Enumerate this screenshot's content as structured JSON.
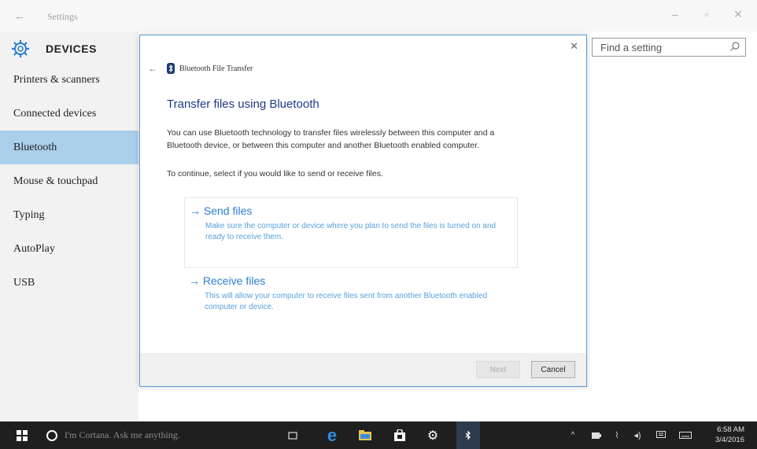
{
  "window": {
    "title": "Settings",
    "back_icon": "back-arrow-icon",
    "controls": [
      "minimize-icon",
      "maximize-icon",
      "close-icon"
    ]
  },
  "sidebar": {
    "header": "DEVICES",
    "header_icon": "gear-icon",
    "items": [
      {
        "label": "Printers & scanners",
        "active": false
      },
      {
        "label": "Connected devices",
        "active": false
      },
      {
        "label": "Bluetooth",
        "active": true
      },
      {
        "label": "Mouse & touchpad",
        "active": false
      },
      {
        "label": "Typing",
        "active": false
      },
      {
        "label": "AutoPlay",
        "active": false
      },
      {
        "label": "USB",
        "active": false
      }
    ]
  },
  "search": {
    "placeholder": "Find a setting",
    "icon": "search-icon"
  },
  "dialog": {
    "header_title": "Bluetooth File Transfer",
    "title": "Transfer files using Bluetooth",
    "description": "You can use Bluetooth technology to transfer files wirelessly between this computer and a Bluetooth device, or between this computer and another Bluetooth enabled computer.",
    "prompt": "To continue, select if you would like to send or receive files.",
    "options": [
      {
        "title": "→ Send files",
        "text": "Make sure the computer or device where you plan to send the files is turned on and ready to receive them."
      },
      {
        "title": "→ Receive files",
        "text": "This will allow your computer to receive files sent from another Bluetooth enabled computer or device."
      }
    ],
    "next_label": "Next",
    "cancel_label": "Cancel"
  },
  "taskbar": {
    "cortana_text": "I'm Cortana. Ask me anything.",
    "time": "6:58 AM",
    "date": "3/4/2016"
  },
  "colors": {
    "accent": "#2a7fd4",
    "active_nav": "#a9cfeb",
    "dialog_border": "#5b9bd5",
    "taskbar": "#1f1f1f"
  }
}
